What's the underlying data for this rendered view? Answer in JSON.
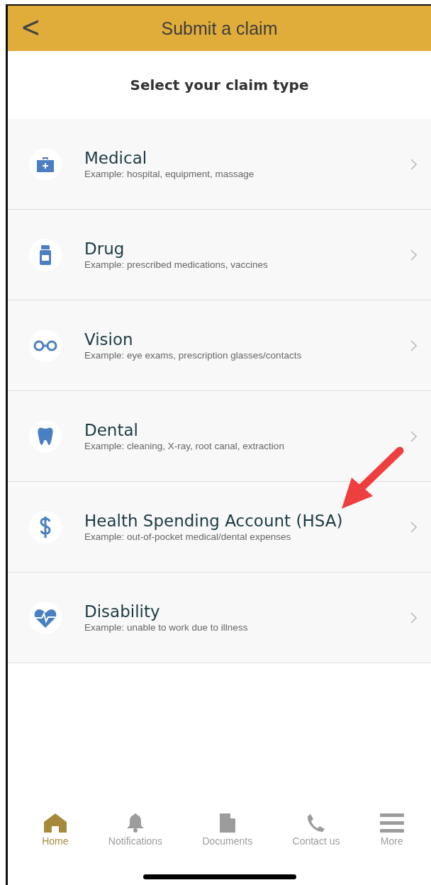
{
  "header": {
    "back": "<",
    "title": "Submit a claim"
  },
  "heading": "Select your claim type",
  "claim_types": [
    {
      "kind": "medical",
      "name": "Medical",
      "example": "Example: hospital, equipment, massage"
    },
    {
      "kind": "drug",
      "name": "Drug",
      "example": "Example: prescribed medications, vaccines"
    },
    {
      "kind": "vision",
      "name": "Vision",
      "example": "Example: eye exams, prescription glasses/contacts"
    },
    {
      "kind": "dental",
      "name": "Dental",
      "example": "Example: cleaning, X-ray, root canal, extraction"
    },
    {
      "kind": "hsa",
      "name": "Health Spending Account (HSA)",
      "example": "Example: out-of-pocket medical/dental expenses"
    },
    {
      "kind": "disability",
      "name": "Disability",
      "example": "Example: unable to work due to illness"
    }
  ],
  "nav": [
    {
      "kind": "home",
      "label": "Home",
      "selected": true
    },
    {
      "kind": "notifications",
      "label": "Notifications",
      "selected": false
    },
    {
      "kind": "documents",
      "label": "Documents",
      "selected": false
    },
    {
      "kind": "contact",
      "label": "Contact us",
      "selected": false
    },
    {
      "kind": "more",
      "label": "More",
      "selected": false
    }
  ]
}
